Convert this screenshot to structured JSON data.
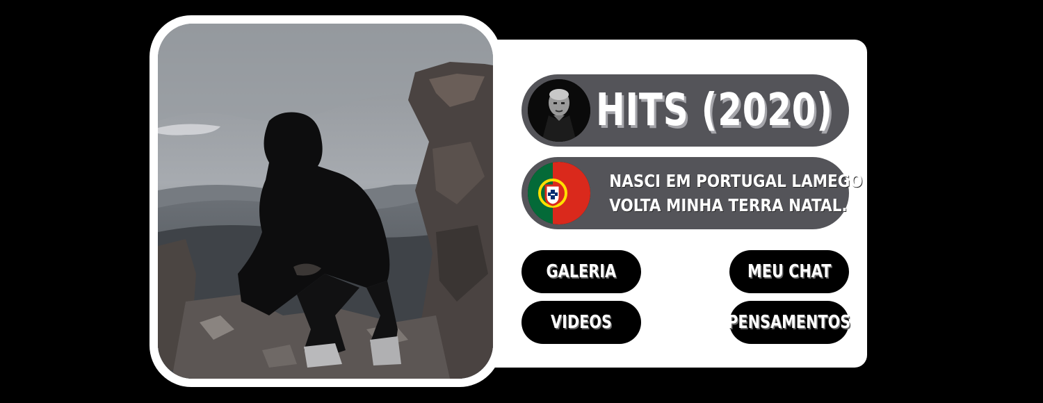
{
  "profile": {
    "title": "HITS (2020)",
    "bio_line1": "NASCI EM PORTUGAL LAMEGO",
    "bio_line2": "VOLTA MINHA TERRA NATAL."
  },
  "nav": {
    "galeria": "GALERIA",
    "videos": "VIDEOS",
    "meu_chat": "MEU CHAT",
    "pensamentos": "PENSAMENTOS"
  },
  "colors": {
    "background": "#000000",
    "card": "#ffffff",
    "pill": "#545459",
    "button": "#000000",
    "flag_green": "#046a38",
    "flag_red": "#da291c"
  }
}
